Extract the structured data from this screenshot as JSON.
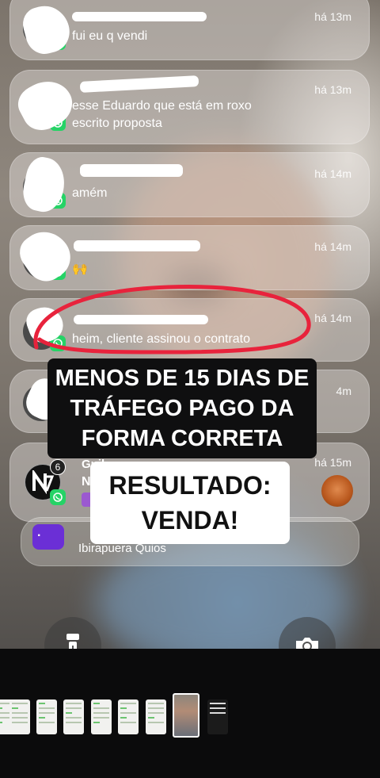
{
  "notifications": [
    {
      "sender": "",
      "message": "fui eu q vendi",
      "time": "há 13m",
      "app": "whatsapp-icon"
    },
    {
      "sender": "",
      "message": "esse Eduardo que está em roxo escrito proposta",
      "message_lines": [
        "esse Eduardo que está em roxo",
        "escrito proposta"
      ],
      "time": "há 13m",
      "app": "whatsapp-icon"
    },
    {
      "sender": "",
      "message": "amém",
      "time": "há 14m",
      "app": "whatsapp-icon"
    },
    {
      "sender": "",
      "message": "🙌",
      "time": "há 14m",
      "app": "whatsapp-icon"
    },
    {
      "sender": "",
      "message": "heim, cliente assinou o contrato",
      "time": "há 14m",
      "app": "whatsapp-icon"
    },
    {
      "sender": "",
      "message": "",
      "time": "há 14m",
      "time_visible": "4m",
      "app": "whatsapp-icon"
    },
    {
      "sender": "Guil",
      "message": "NE",
      "time": "há 15m",
      "app": "whatsapp-icon",
      "badge_count": "6"
    },
    {
      "sender": "",
      "message": "Ibirapuera Quios",
      "time": "",
      "app": "app-icon"
    }
  ],
  "caption_top": {
    "lines": [
      "MENOS DE 15 DIAS DE",
      "TRÁFEGO PAGO DA",
      "FORMA CORRETA"
    ]
  },
  "caption_bottom": {
    "lines": [
      "RESULTADO:",
      "VENDA!"
    ]
  },
  "controls": {
    "flashlight": "flashlight-icon",
    "camera": "camera-icon"
  },
  "colors": {
    "whatsapp": "#25d366",
    "highlight_ring": "#e8233c",
    "caption_dark": "#0f0f10",
    "caption_light": "#ffffff"
  }
}
